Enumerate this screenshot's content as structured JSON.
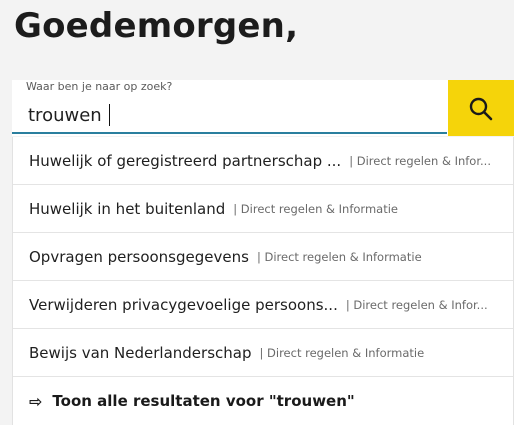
{
  "greeting": "Goedemorgen,",
  "search": {
    "label": "Waar ben je naar op zoek?",
    "value": "trouwen",
    "button_icon": "search-icon",
    "button_color": "#f5d40a",
    "underline_color": "#2a7f9e"
  },
  "suggestions": [
    {
      "title": "Huwelijk of geregistreerd partnerschap ...",
      "category": "| Direct regelen & Infor..."
    },
    {
      "title": "Huwelijk in het buitenland",
      "category": "| Direct regelen & Informatie"
    },
    {
      "title": "Opvragen persoonsgegevens",
      "category": "| Direct regelen & Informatie"
    },
    {
      "title": "Verwijderen privacygevoelige persoons...",
      "category": "| Direct regelen & Infor..."
    },
    {
      "title": "Bewijs van Nederlanderschap",
      "category": "| Direct regelen & Informatie"
    }
  ],
  "show_all": {
    "arrow_icon": "arrow-right-icon",
    "label": "Toon alle resultaten voor \"trouwen\""
  }
}
